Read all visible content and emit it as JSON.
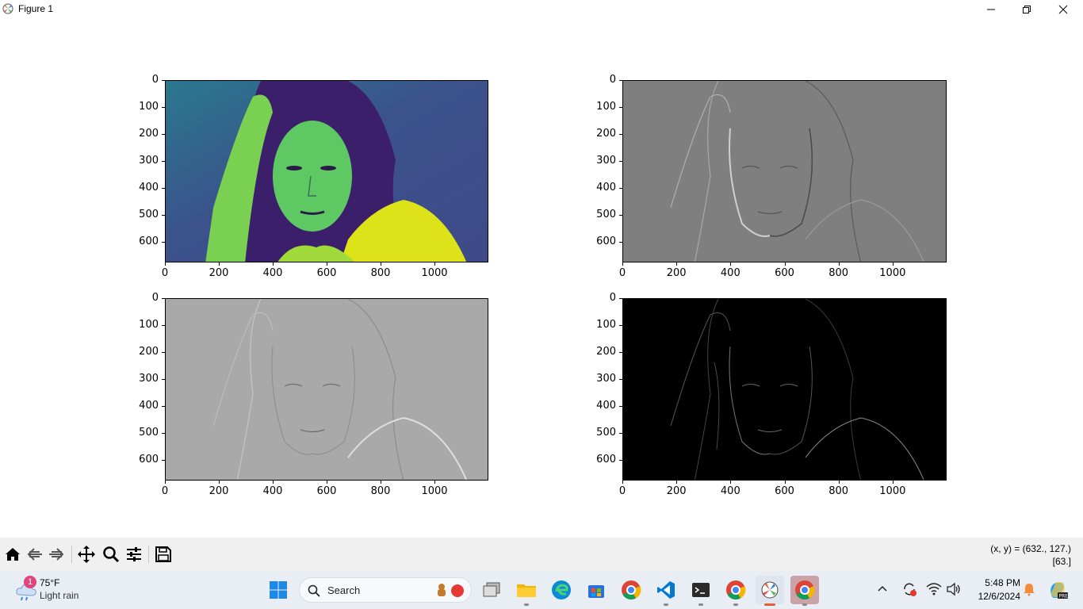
{
  "window": {
    "title": "Figure 1",
    "minimize_icon": "minimize-icon",
    "maximize_icon": "restore-icon",
    "close_icon": "close-icon"
  },
  "figure": {
    "panels": [
      {
        "name": "original-image-plot",
        "colormap": "viridis",
        "y_ticks": [
          "0",
          "100",
          "200",
          "300",
          "400",
          "500",
          "600"
        ],
        "x_ticks": [
          "0",
          "200",
          "400",
          "600",
          "800",
          "1000"
        ]
      },
      {
        "name": "sobel-x-plot",
        "colormap": "gray",
        "y_ticks": [
          "0",
          "100",
          "200",
          "300",
          "400",
          "500",
          "600"
        ],
        "x_ticks": [
          "0",
          "200",
          "400",
          "600",
          "800",
          "1000"
        ]
      },
      {
        "name": "sobel-y-plot",
        "colormap": "gray",
        "y_ticks": [
          "0",
          "100",
          "200",
          "300",
          "400",
          "500",
          "600"
        ],
        "x_ticks": [
          "0",
          "200",
          "400",
          "600",
          "800",
          "1000"
        ]
      },
      {
        "name": "magnitude-plot",
        "colormap": "gray",
        "y_ticks": [
          "0",
          "100",
          "200",
          "300",
          "400",
          "500",
          "600"
        ],
        "x_ticks": [
          "0",
          "200",
          "400",
          "600",
          "800",
          "1000"
        ]
      }
    ]
  },
  "toolbar": {
    "buttons": [
      "home-icon",
      "back-icon",
      "forward-icon",
      "pan-icon",
      "zoom-icon",
      "configure-subplots-icon",
      "save-icon"
    ],
    "coords_line1": "(x, y) = (632., 127.)",
    "coords_line2": "[63.]"
  },
  "taskbar": {
    "weather_temp": "75°F",
    "weather_desc": "Light rain",
    "weather_badge": "1",
    "search_label": "Search",
    "time": "5:48 PM",
    "date": "12/6/2024"
  }
}
